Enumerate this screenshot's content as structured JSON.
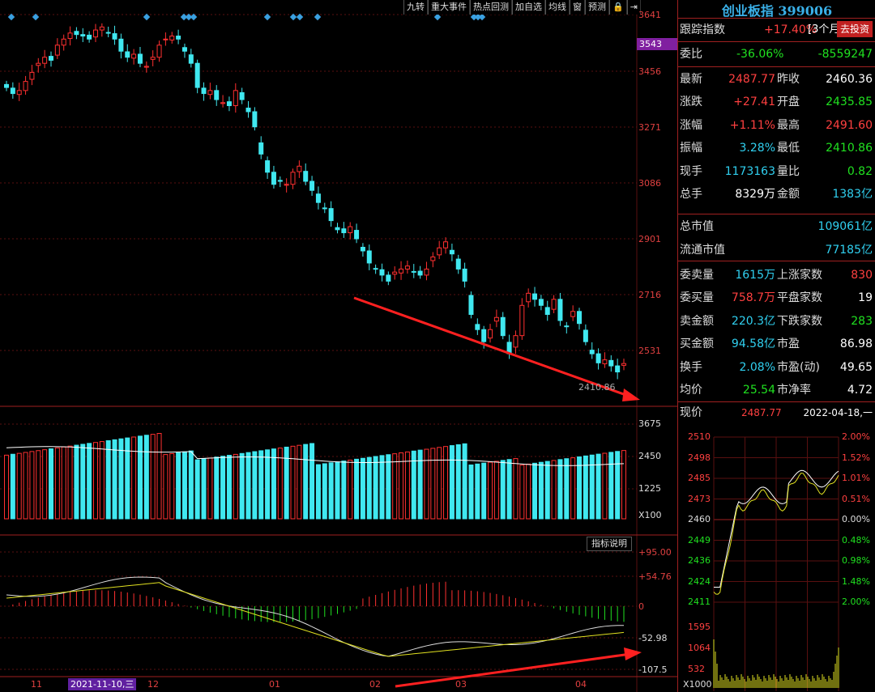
{
  "toolbar": {
    "items": [
      "九转",
      "重大事件",
      "热点回测",
      "加自选",
      "均线",
      "窗",
      "预测",
      "🔒",
      "⇥"
    ]
  },
  "price_axis": {
    "labels": [
      "3641",
      "3456",
      "3271",
      "3086",
      "2901",
      "2716",
      "2531"
    ],
    "current_tag": "3543"
  },
  "volume_axis": {
    "labels": [
      "3675",
      "2450",
      "1225",
      "X100"
    ]
  },
  "indicator_axis": {
    "labels": [
      "+95.00",
      "+54.76",
      "0",
      "-52.98",
      "-107.5"
    ]
  },
  "indicator_button": "指标说明",
  "low_label": "2410.86",
  "x_axis": {
    "labels": [
      "11",
      "12",
      "01",
      "02",
      "03",
      "04"
    ],
    "selected_date": "2021-11-10,三"
  },
  "panel": {
    "title": "创业板指 399006",
    "track": {
      "label": "跟踪指数",
      "value": "+17.40%",
      "period": "[3个月]",
      "button": "去投资"
    },
    "weibi": {
      "label": "委比",
      "pct": "-36.06%",
      "diff": "-8559247"
    },
    "rows1": [
      {
        "l1": "最新",
        "v1": "2487.77",
        "c1": "red",
        "l2": "昨收",
        "v2": "2460.36",
        "c2": "wht"
      },
      {
        "l1": "涨跌",
        "v1": "+27.41",
        "c1": "red",
        "l2": "开盘",
        "v2": "2435.85",
        "c2": "grn"
      },
      {
        "l1": "涨幅",
        "v1": "+1.11%",
        "c1": "red",
        "l2": "最高",
        "v2": "2491.60",
        "c2": "red"
      },
      {
        "l1": "振幅",
        "v1": "3.28%",
        "c1": "cyan",
        "l2": "最低",
        "v2": "2410.86",
        "c2": "grn"
      },
      {
        "l1": "现手",
        "v1": "1173163",
        "c1": "cyan",
        "l2": "量比",
        "v2": "0.82",
        "c2": "grn"
      },
      {
        "l1": "总手",
        "v1": "8329万",
        "c1": "wht",
        "l2": "金额",
        "v2": "1383亿",
        "c2": "cyan"
      }
    ],
    "cap": [
      {
        "l": "总市值",
        "v": "109061亿"
      },
      {
        "l": "流通市值",
        "v": "77185亿"
      }
    ],
    "rows2": [
      {
        "l1": "委卖量",
        "v1": "1615万",
        "c1": "cyan",
        "l2": "上涨家数",
        "v2": "830",
        "c2": "red"
      },
      {
        "l1": "委买量",
        "v1": "758.7万",
        "c1": "red",
        "l2": "平盘家数",
        "v2": "19",
        "c2": "wht"
      },
      {
        "l1": "卖金额",
        "v1": "220.3亿",
        "c1": "cyan",
        "l2": "下跌家数",
        "v2": "283",
        "c2": "grn"
      },
      {
        "l1": "买金额",
        "v1": "94.58亿",
        "c1": "cyan",
        "l2": "市盈",
        "v2": "86.98",
        "c2": "wht"
      },
      {
        "l1": "换手",
        "v1": "2.08%",
        "c1": "cyan",
        "l2": "市盈(动)",
        "v2": "49.65",
        "c2": "wht"
      },
      {
        "l1": "均价",
        "v1": "25.54",
        "c1": "grn",
        "l2": "市净率",
        "v2": "4.72",
        "c2": "wht"
      }
    ],
    "now": {
      "label": "现价",
      "value": "2487.77",
      "date": "2022-04-18,一"
    },
    "mini": {
      "left": [
        "2510",
        "2498",
        "2485",
        "2473",
        "2460",
        "2449",
        "2436",
        "2424",
        "2411"
      ],
      "right": [
        "2.00%",
        "1.52%",
        "1.01%",
        "0.51%",
        "0.00%",
        "0.48%",
        "0.98%",
        "1.48%",
        "2.00%"
      ],
      "vol": [
        "1595",
        "1064",
        "532",
        "X1000"
      ]
    }
  },
  "colors": {
    "up": "#ff3030",
    "down": "#40e8f0",
    "ma": "#ffffff",
    "grid": "#5a1010"
  },
  "chart_data": {
    "type": "candlestick",
    "title": "创业板指 399006",
    "ohlc_approx_close": [
      3400,
      3380,
      3390,
      3420,
      3450,
      3480,
      3500,
      3490,
      3540,
      3560,
      3580,
      3575,
      3570,
      3560,
      3590,
      3600,
      3580,
      3560,
      3520,
      3500,
      3510,
      3480,
      3470,
      3500,
      3540,
      3560,
      3570,
      3560,
      3520,
      3480,
      3400,
      3380,
      3390,
      3360,
      3350,
      3340,
      3390,
      3360,
      3320,
      3270,
      3180,
      3120,
      3080,
      3090,
      3080,
      3120,
      3140,
      3090,
      3060,
      3020,
      3000,
      2960,
      2930,
      2920,
      2940,
      2900,
      2860,
      2820,
      2800,
      2780,
      2760,
      2790,
      2800,
      2810,
      2790,
      2780,
      2800,
      2840,
      2870,
      2890,
      2850,
      2800,
      2760,
      2650,
      2600,
      2560,
      2600,
      2640,
      2580,
      2520,
      2580,
      2680,
      2720,
      2700,
      2680,
      2650,
      2700,
      2630,
      2610,
      2660,
      2620,
      2560,
      2520,
      2490,
      2500,
      2480,
      2460,
      2487.77
    ],
    "volume_ma_note": "",
    "macd_range": [
      -107.5,
      95.0
    ]
  }
}
